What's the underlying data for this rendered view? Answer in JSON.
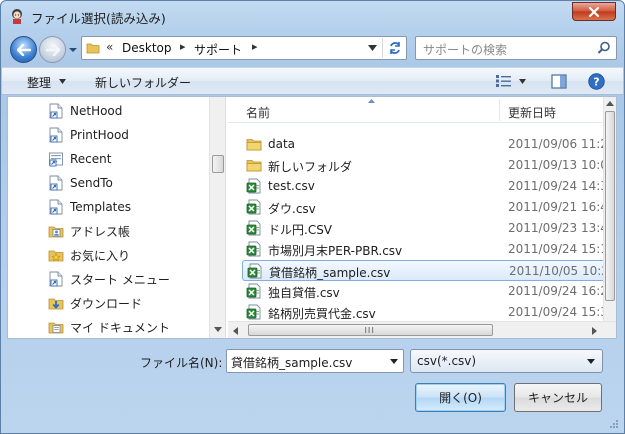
{
  "window": {
    "title": "ファイル選択(読み込み)"
  },
  "address": {
    "chevron": "«",
    "crumbs": [
      "Desktop",
      "サポート"
    ],
    "separator": "▸"
  },
  "search": {
    "placeholder": "サポートの検索"
  },
  "toolbar": {
    "organize": "整理",
    "new_folder": "新しいフォルダー"
  },
  "nav_items": [
    {
      "label": "NetHood",
      "icon": "shortcut-icon"
    },
    {
      "label": "PrintHood",
      "icon": "shortcut-icon"
    },
    {
      "label": "Recent",
      "icon": "recent-icon"
    },
    {
      "label": "SendTo",
      "icon": "shortcut-icon"
    },
    {
      "label": "Templates",
      "icon": "shortcut-icon"
    },
    {
      "label": "アドレス帳",
      "icon": "contacts-icon"
    },
    {
      "label": "お気に入り",
      "icon": "favorites-icon"
    },
    {
      "label": "スタート メニュー",
      "icon": "shortcut-icon"
    },
    {
      "label": "ダウンロード",
      "icon": "download-icon"
    },
    {
      "label": "マイ ドキュメント",
      "icon": "documents-icon"
    }
  ],
  "columns": {
    "name": "名前",
    "date": "更新日時"
  },
  "files": [
    {
      "name": "data",
      "date": "2011/09/06 11:2",
      "type": "folder"
    },
    {
      "name": "新しいフォルダ",
      "date": "2011/09/13 10:0",
      "type": "folder"
    },
    {
      "name": "test.csv",
      "date": "2011/09/24 14:3",
      "type": "csv"
    },
    {
      "name": "ダウ.csv",
      "date": "2011/09/21 16:4",
      "type": "csv"
    },
    {
      "name": "ドル円.CSV",
      "date": "2011/09/23 13:4",
      "type": "csv"
    },
    {
      "name": "市場別月末PER-PBR.csv",
      "date": "2011/09/24 15:1",
      "type": "csv"
    },
    {
      "name": "貸借銘柄_sample.csv",
      "date": "2011/10/05 10:2",
      "type": "csv",
      "selected": true
    },
    {
      "name": "独自貸借.csv",
      "date": "2011/09/24 16:2",
      "type": "csv"
    },
    {
      "name": "銘柄別売買代金.csv",
      "date": "2011/09/24 15:3",
      "type": "csv"
    }
  ],
  "footer": {
    "filename_label": "ファイル名(N):",
    "filename_value": "貸借銘柄_sample.csv",
    "filter_value": "csv(*.csv)",
    "open_label": "開く(O)",
    "cancel_label": "キャンセル"
  },
  "colors": {
    "accent": "#3a7dd1",
    "selection_border": "#84acdd",
    "folder": "#e8c35a",
    "csv": "#2e8b3a"
  }
}
